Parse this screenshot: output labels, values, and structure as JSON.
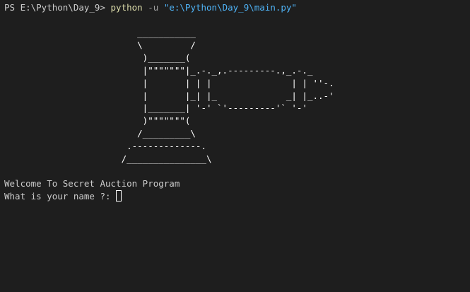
{
  "terminal": {
    "command_line": {
      "prompt": "PS E:\\Python\\Day_9>",
      "command": "python",
      "flag": "-u",
      "path": "\"e:\\Python\\Day_9\\main.py\""
    },
    "ascii_art": "                         ___________\n                         \\         /\n                          )_______(\n                          |\"\"\"\"\"\"\"|_.-._,.---------.,_.-._\n                          |       | | |               | | ''-.\n                          |       |_| |_             _| |_..-'\n                          |_______| '-' `'---------'` '-'\n                          )\"\"\"\"\"\"\"(\n                         /_________\\\n                       .-------------.\n                      /_______________\\",
    "welcome_text": "Welcome To Secret Auction Program",
    "name_prompt": "What is your name ?: "
  }
}
